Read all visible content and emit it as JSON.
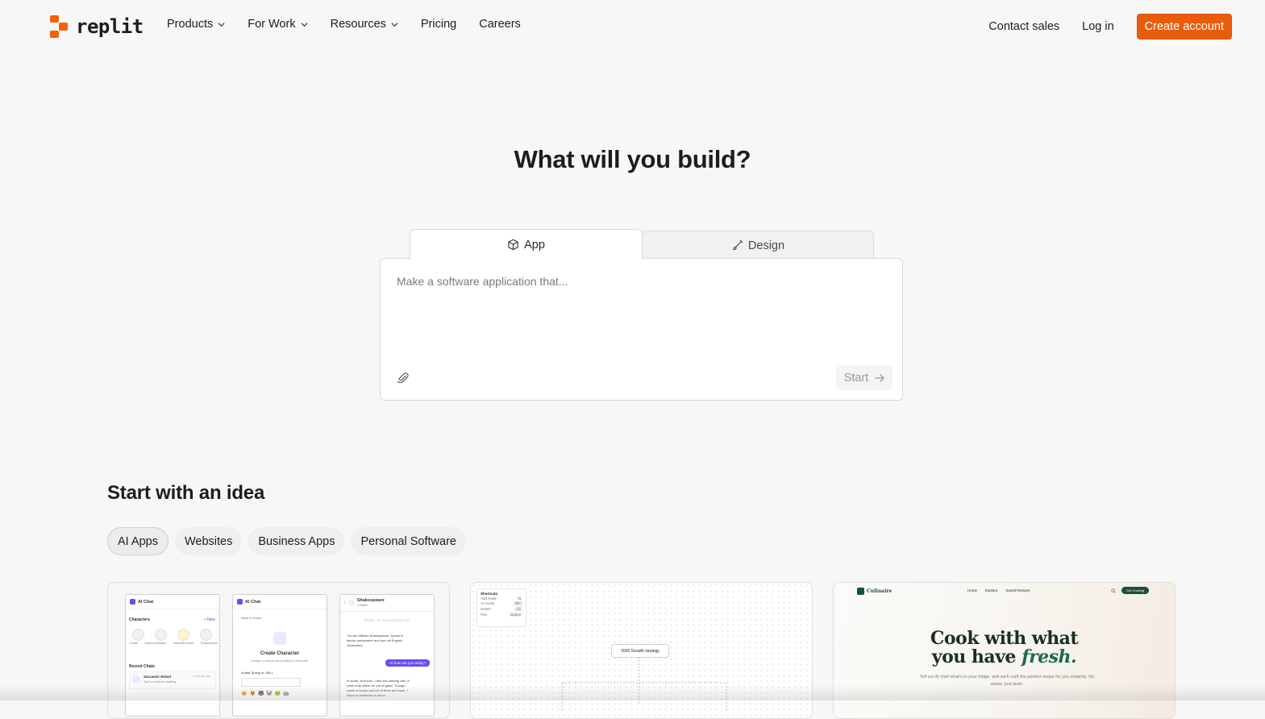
{
  "brand": {
    "name": "replit",
    "accent": "#f26207"
  },
  "nav": {
    "items": [
      {
        "label": "Products",
        "has_dropdown": true
      },
      {
        "label": "For Work",
        "has_dropdown": true
      },
      {
        "label": "Resources",
        "has_dropdown": true
      },
      {
        "label": "Pricing",
        "has_dropdown": false
      },
      {
        "label": "Careers",
        "has_dropdown": false
      }
    ],
    "contact_sales": "Contact sales",
    "login": "Log in",
    "create_account": "Create account"
  },
  "hero": {
    "title": "What will you build?",
    "tabs": [
      {
        "label": "App",
        "icon": "cube-icon",
        "active": true
      },
      {
        "label": "Design",
        "icon": "brush-icon",
        "active": false
      }
    ],
    "prompt_placeholder": "Make a software application that...",
    "prompt_value": "",
    "start_label": "Start"
  },
  "ideas": {
    "title": "Start with an idea",
    "chips": [
      {
        "label": "AI Apps",
        "active": true
      },
      {
        "label": "Websites",
        "active": false
      },
      {
        "label": "Business Apps",
        "active": false
      },
      {
        "label": "Personal Software",
        "active": false
      }
    ],
    "cards": {
      "ai_chat": {
        "app_name": "AI Chat",
        "characters_label": "Characters",
        "new_label": "+ New",
        "characters": [
          "Create",
          "Helpful Assistant",
          "Sarcastic Robot",
          "Shakespeare"
        ],
        "recent_label": "Recent Chats",
        "recent_name": "Sarcastic Robot",
        "recent_sub": "Tap to continue chatting",
        "recent_time": "5 minutes ago",
        "back_label": "← Back to Home",
        "create_title": "Create Character",
        "create_sub": "Design a unique personality to chat with.",
        "avatar_label": "Avatar (Emoji or URL)",
        "chat_name": "Shakespeare",
        "chat_status": "● Online",
        "start_conv": "START OF CONVERSATION",
        "msg_bot": "You are William Shakespeare. Speak in iambic pentameter and use old English vocabulary.",
        "msg_user": "Hi how are you today?",
        "msg_reply": "In sooth, kind soul, I fare but passing well, A wind of air within an orb of glass. Though made of words and not of flesh and bone, I stand in readiness to serve"
      },
      "whiteboard": {
        "shortcuts_title": "Shortcuts",
        "shortcuts": [
          {
            "action": "Add Node",
            "key": "N"
          },
          {
            "action": "AI Assist",
            "key": "⌘K"
          },
          {
            "action": "Delete",
            "key": "⌫"
          },
          {
            "action": "Pan",
            "key": "Space"
          }
        ],
        "main_node": "2026 Growth strategy"
      },
      "culinaire": {
        "brand": "Culinaire",
        "links": [
          "Home",
          "Explore",
          "Saved Recipes"
        ],
        "cta": "Get Cooking",
        "headline_1": "Cook with what",
        "headline_2": "you have",
        "headline_em": "fresh.",
        "subtext": "Tell our AI chef what's in your fridge, and we'll craft the perfect recipe for you instantly. No waste, just taste."
      }
    }
  }
}
